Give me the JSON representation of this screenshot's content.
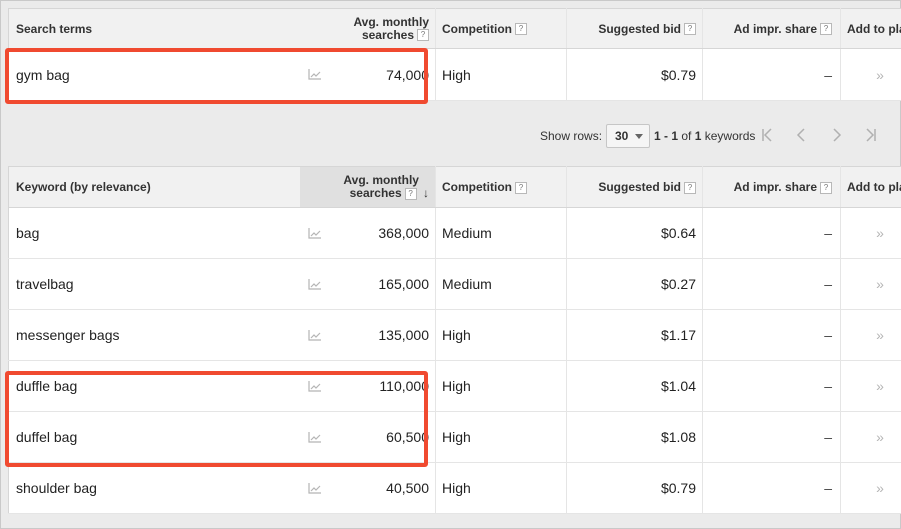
{
  "search_table": {
    "headers": {
      "term": "Search terms",
      "avg_line1": "Avg. monthly",
      "avg_line2": "searches",
      "competition": "Competition",
      "bid": "Suggested bid",
      "share": "Ad impr. share",
      "add": "Add to plan"
    },
    "rows": [
      {
        "term": "gym bag",
        "avg": "74,000",
        "competition": "High",
        "bid": "$0.79",
        "share": "–",
        "add": "»"
      }
    ]
  },
  "pager": {
    "show_rows_label": "Show rows:",
    "rows_value": "30",
    "range_bold": "1 - 1",
    "range_of": "of",
    "range_total": "1",
    "range_suffix": "keywords",
    "first_icon": "first-page-icon",
    "prev_icon": "prev-page-icon",
    "next_icon": "next-page-icon",
    "last_icon": "last-page-icon"
  },
  "keyword_table": {
    "headers": {
      "keyword": "Keyword (by relevance)",
      "avg_line1": "Avg. monthly",
      "avg_line2": "searches",
      "sort_icon": "↓",
      "competition": "Competition",
      "bid": "Suggested bid",
      "share": "Ad impr. share",
      "add": "Add to plan"
    },
    "rows": [
      {
        "keyword": "bag",
        "avg": "368,000",
        "competition": "Medium",
        "bid": "$0.64",
        "share": "–",
        "add": "»"
      },
      {
        "keyword": "travelbag",
        "avg": "165,000",
        "competition": "Medium",
        "bid": "$0.27",
        "share": "–",
        "add": "»"
      },
      {
        "keyword": "messenger bags",
        "avg": "135,000",
        "competition": "High",
        "bid": "$1.17",
        "share": "–",
        "add": "»"
      },
      {
        "keyword": "duffle bag",
        "avg": "110,000",
        "competition": "High",
        "bid": "$1.04",
        "share": "–",
        "add": "»"
      },
      {
        "keyword": "duffel bag",
        "avg": "60,500",
        "competition": "High",
        "bid": "$1.08",
        "share": "–",
        "add": "»"
      },
      {
        "keyword": "shoulder bag",
        "avg": "40,500",
        "competition": "High",
        "bid": "$0.79",
        "share": "–",
        "add": "»"
      }
    ]
  },
  "help_icon": "?",
  "colors": {
    "highlight": "#f04a30",
    "header_bg": "#f1f1f1",
    "sorted_bg": "#e0e0e0"
  }
}
